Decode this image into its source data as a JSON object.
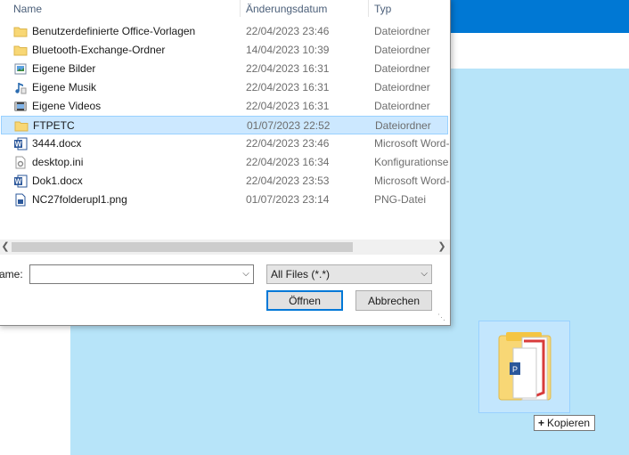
{
  "dialog": {
    "columns": {
      "name": "Name",
      "date": "Änderungsdatum",
      "type": "Typ"
    },
    "files": [
      {
        "name": "Benutzerdefinierte Office-Vorlagen",
        "date": "22/04/2023 23:46",
        "type": "Dateiordner",
        "icon": "folder-icon"
      },
      {
        "name": "Bluetooth-Exchange-Ordner",
        "date": "14/04/2023 10:39",
        "type": "Dateiordner",
        "icon": "folder-icon"
      },
      {
        "name": "Eigene Bilder",
        "date": "22/04/2023 16:31",
        "type": "Dateiordner",
        "icon": "pictures-shortcut-icon"
      },
      {
        "name": "Eigene Musik",
        "date": "22/04/2023 16:31",
        "type": "Dateiordner",
        "icon": "music-shortcut-icon"
      },
      {
        "name": "Eigene Videos",
        "date": "22/04/2023 16:31",
        "type": "Dateiordner",
        "icon": "videos-shortcut-icon"
      },
      {
        "name": "FTPETC",
        "date": "01/07/2023 22:52",
        "type": "Dateiordner",
        "icon": "folder-icon",
        "selected": true
      },
      {
        "name": "3444.docx",
        "date": "22/04/2023 23:46",
        "type": "Microsoft Word-",
        "icon": "word-document-icon"
      },
      {
        "name": "desktop.ini",
        "date": "22/04/2023 16:34",
        "type": "Konfigurationse",
        "icon": "settings-file-icon"
      },
      {
        "name": "Dok1.docx",
        "date": "22/04/2023 23:53",
        "type": "Microsoft Word-",
        "icon": "word-document-icon"
      },
      {
        "name": "NC27folderupl1.png",
        "date": "01/07/2023 23:14",
        "type": "PNG-Datei",
        "icon": "image-file-icon"
      }
    ],
    "filename_label": "ame:",
    "filename_value": "",
    "filter_value": "All Files (*.*)",
    "open_label": "Öffnen",
    "cancel_label": "Abbrechen"
  },
  "drag": {
    "copy_label": "Kopieren"
  },
  "colors": {
    "accent": "#0078d4",
    "light_bg": "#b7e4f9",
    "selection": "#cce8ff",
    "folder": "#f8d775"
  }
}
